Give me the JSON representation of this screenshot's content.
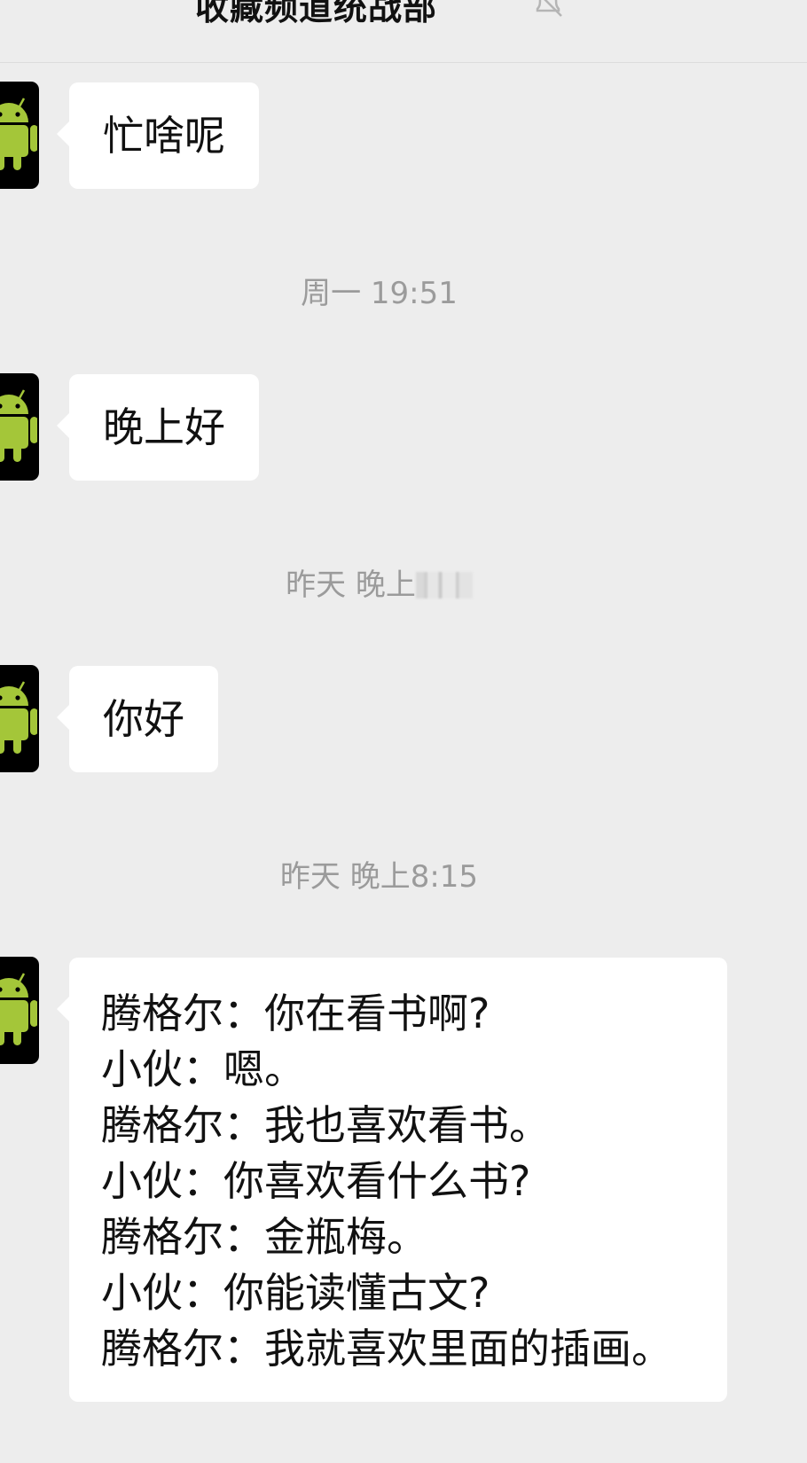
{
  "header": {
    "title": "收藏频道统战部"
  },
  "messages": [
    {
      "type": "text",
      "text": "忙啥呢"
    },
    {
      "type": "time",
      "text": "周一 19:51"
    },
    {
      "type": "text",
      "text": "晚上好"
    },
    {
      "type": "time",
      "text": "昨天 晚上"
    },
    {
      "type": "text",
      "text": "你好"
    },
    {
      "type": "time",
      "text": "昨天 晚上8:15"
    },
    {
      "type": "dialogue",
      "lines": [
        "腾格尔：你在看书啊?",
        "小伙：嗯。",
        "腾格尔：我也喜欢看书。",
        "小伙：你喜欢看什么书?",
        "腾格尔：金瓶梅。",
        "小伙：你能读懂古文?",
        "腾格尔：我就喜欢里面的插画。"
      ]
    }
  ],
  "icons": {
    "avatar": "android-icon",
    "mute": "bell-off-icon",
    "more": "more-dots-icon"
  },
  "colors": {
    "background": "#ededed",
    "bubble": "#ffffff",
    "timestamp_text": "#9b9b9b",
    "android_green": "#a4c639"
  }
}
